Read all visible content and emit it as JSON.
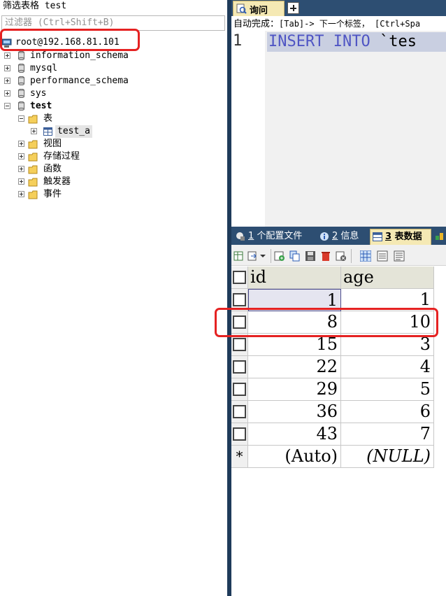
{
  "filter": {
    "title": "筛选表格 test",
    "placeholder": "过滤器 (Ctrl+Shift+B)"
  },
  "tree": {
    "connection": "root@192.168.81.101",
    "databases": [
      "information_schema",
      "mysql",
      "performance_schema",
      "sys",
      "test"
    ],
    "test_children": {
      "tables_folder": "表",
      "table": "test_a",
      "folders": [
        "视图",
        "存储过程",
        "函数",
        "触发器",
        "事件"
      ]
    }
  },
  "query": {
    "tab_label": "询问",
    "autocomplete_label": "自动完成：",
    "autocomplete_hint": "[Tab]-> 下一个标签， [Ctrl+Spa",
    "line_number": "1",
    "code_kw1": "INSERT",
    "code_kw2": "INTO",
    "code_rest": "`tes"
  },
  "result_tabs": [
    {
      "num": "1",
      "label": "个配置文件"
    },
    {
      "num": "2",
      "label": "信息"
    },
    {
      "num": "3",
      "label": "表数据"
    }
  ],
  "grid": {
    "columns": [
      "id",
      "age"
    ],
    "rows": [
      {
        "id": "1",
        "age": "1"
      },
      {
        "id": "8",
        "age": "10"
      },
      {
        "id": "15",
        "age": "3"
      },
      {
        "id": "22",
        "age": "4"
      },
      {
        "id": "29",
        "age": "5"
      },
      {
        "id": "36",
        "age": "6"
      },
      {
        "id": "43",
        "age": "7"
      }
    ],
    "new_row": {
      "marker": "*",
      "id": "(Auto)",
      "age": "(NULL)"
    }
  },
  "colors": {
    "accent_tab": "#f5e9b4",
    "tab_bar": "#2d4e72",
    "highlight": "#e52222",
    "keyword": "#4f55c4"
  }
}
